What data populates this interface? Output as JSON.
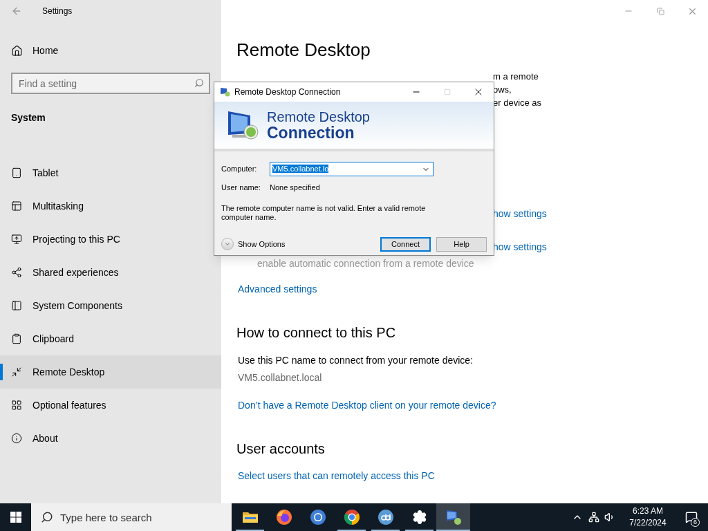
{
  "settings": {
    "title": "Settings",
    "home": "Home",
    "search": {
      "placeholder": "Find a setting"
    },
    "section": "System",
    "nav": [
      {
        "kind": "tablet",
        "label": "Tablet",
        "selected": false
      },
      {
        "kind": "multitasking",
        "label": "Multitasking",
        "selected": false
      },
      {
        "kind": "projecting",
        "label": "Projecting to this PC",
        "selected": false
      },
      {
        "kind": "shared",
        "label": "Shared experiences",
        "selected": false
      },
      {
        "kind": "components",
        "label": "System Components",
        "selected": false
      },
      {
        "kind": "clipboard",
        "label": "Clipboard",
        "selected": false
      },
      {
        "kind": "remote",
        "label": "Remote Desktop",
        "selected": true
      },
      {
        "kind": "optional",
        "label": "Optional features",
        "selected": false
      },
      {
        "kind": "about",
        "label": "About",
        "selected": false
      }
    ],
    "page_title": "Remote Desktop",
    "intro_fragments": [
      "m a remote",
      "ows,",
      "er device as"
    ],
    "setting_links_fragments": [
      "how settings",
      "how settings"
    ],
    "hint_fragment": "enable automatic connection from a remote device",
    "advanced_link": "Advanced settings",
    "connect_heading": "How to connect to this PC",
    "connect_text": "Use this PC name to connect from your remote device:",
    "pc_name": "VM5.collabnet.local",
    "client_link": "Don’t have a Remote Desktop client on your remote device?",
    "accounts_heading": "User accounts",
    "accounts_link": "Select users that can remotely access this PC"
  },
  "dialog": {
    "title": "Remote Desktop Connection",
    "banner_line1": "Remote Desktop",
    "banner_line2": "Connection",
    "computer_label": "Computer:",
    "computer_value": "VM5.collabnet.lo",
    "value_selected": true,
    "user_label": "User name:",
    "user_value": "None specified",
    "message": "The remote computer name is not valid. Enter a valid remote computer name.",
    "show_options": "Show Options",
    "buttons": [
      {
        "label": "Connect",
        "default": true
      },
      {
        "label": "Help",
        "default": false
      }
    ]
  },
  "taskbar": {
    "search_placeholder": "Type here to search",
    "apps": [
      {
        "kind": "files",
        "running": true,
        "active": false
      },
      {
        "kind": "firefox",
        "running": false,
        "active": false
      },
      {
        "kind": "chromium",
        "running": false,
        "active": false
      },
      {
        "kind": "chrome",
        "running": true,
        "active": false
      },
      {
        "kind": "qbittorrent",
        "running": true,
        "active": false
      },
      {
        "kind": "settings",
        "running": true,
        "active": false
      },
      {
        "kind": "remote",
        "running": true,
        "active": true
      }
    ],
    "time": "6:23 AM",
    "date": "7/22/2024",
    "notifications": "6"
  }
}
